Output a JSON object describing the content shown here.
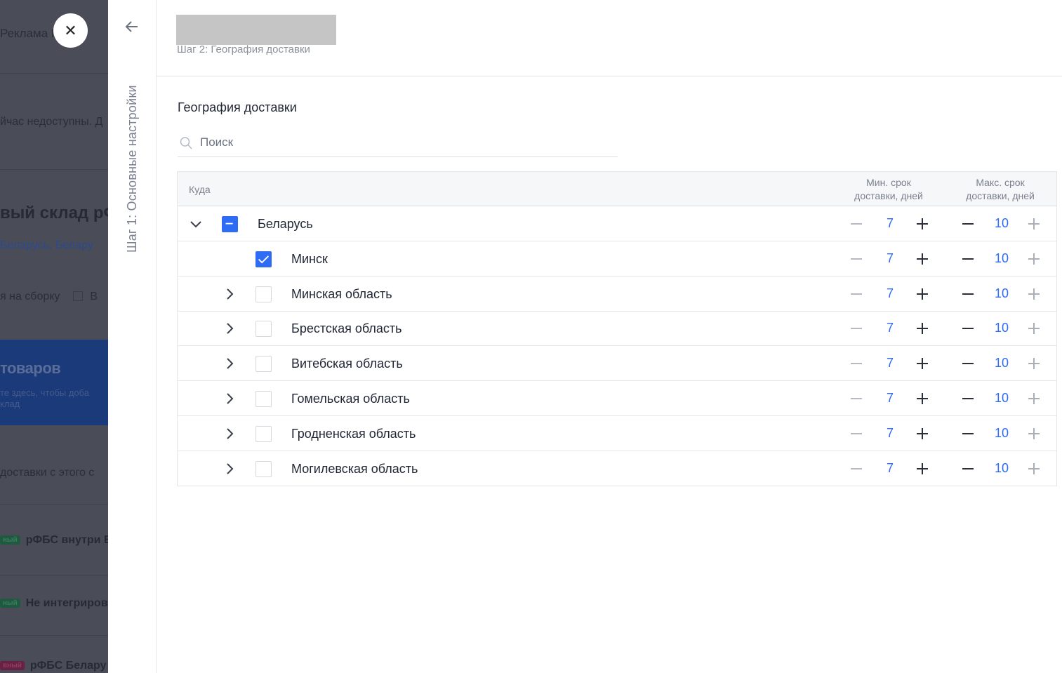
{
  "background": {
    "tab_label": "Реклама  Пр",
    "notice_text": "йчас недоступны. Д",
    "warehouse_title": "вый склад рФ",
    "warehouse_regions": "Беларусь, Белару",
    "assembly_text": "я на сборку",
    "assembly_extra": "В",
    "banner_title": "товаров",
    "banner_subtitle_1": "те здесь, чтобы доба",
    "banner_subtitle_2": "клад",
    "delivery_text": "доставки с этого с",
    "items": [
      {
        "badge": "ный",
        "badge_color": "#2a7a55",
        "text": "рФБС внутри Б"
      },
      {
        "badge": "ный",
        "badge_color": "#2a7a55",
        "text": "Не интегриров"
      },
      {
        "badge": "вный",
        "badge_color": "#8a2a55",
        "text": "рФБС Белару"
      }
    ]
  },
  "close_icon": "close-icon",
  "rail": {
    "back_icon": "arrow-left-icon",
    "step_label": "Шаг 1: Основные настройки"
  },
  "header": {
    "step_label": "Шаг 2: География доставки"
  },
  "section_title": "География доставки",
  "search": {
    "placeholder": "Поиск",
    "value": ""
  },
  "table": {
    "col_where": "Куда",
    "col_min": [
      "Мин. срок",
      "доставки, дней"
    ],
    "col_max": [
      "Макс. срок",
      "доставки, дней"
    ],
    "rows": [
      {
        "label": "Беларусь",
        "level": 0,
        "expander": "chevron-down",
        "checkbox": "indeterminate",
        "min": "7",
        "max": "10"
      },
      {
        "label": "Минск",
        "level": 1,
        "expander": "none",
        "checkbox": "checked",
        "min": "7",
        "max": "10"
      },
      {
        "label": "Минская область",
        "level": 1,
        "expander": "chevron-right",
        "checkbox": "unchecked",
        "min": "7",
        "max": "10"
      },
      {
        "label": "Брестская область",
        "level": 1,
        "expander": "chevron-right",
        "checkbox": "unchecked",
        "min": "7",
        "max": "10"
      },
      {
        "label": "Витебская область",
        "level": 1,
        "expander": "chevron-right",
        "checkbox": "unchecked",
        "min": "7",
        "max": "10"
      },
      {
        "label": "Гомельская область",
        "level": 1,
        "expander": "chevron-right",
        "checkbox": "unchecked",
        "min": "7",
        "max": "10"
      },
      {
        "label": "Гродненская область",
        "level": 1,
        "expander": "chevron-right",
        "checkbox": "unchecked",
        "min": "7",
        "max": "10"
      },
      {
        "label": "Могилевская область",
        "level": 1,
        "expander": "chevron-right",
        "checkbox": "unchecked",
        "min": "7",
        "max": "10"
      }
    ]
  },
  "colors": {
    "accent": "#2f6cf6",
    "text": "#1f2533",
    "muted": "#7a8090",
    "overlay": "#4a4d57"
  }
}
